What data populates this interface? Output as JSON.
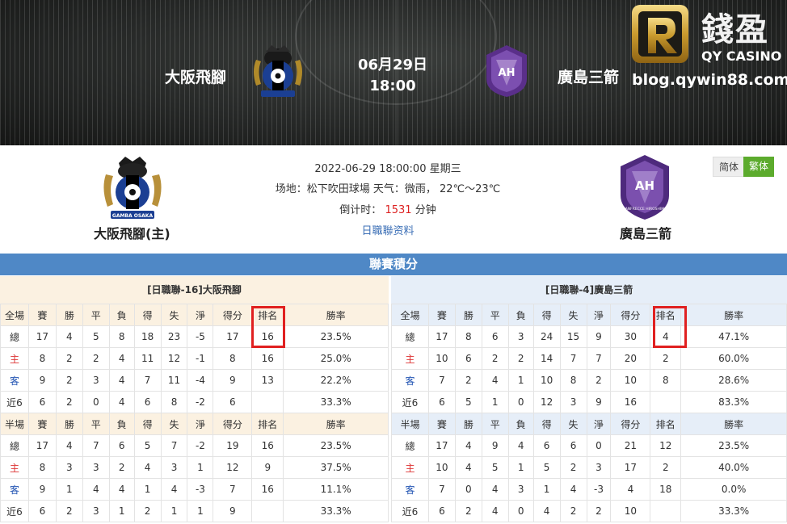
{
  "banner": {
    "home_team": "大阪飛腳",
    "away_team": "廣島三箭",
    "date": "06月29日",
    "time": "18:00",
    "home_logo_text": "GAMBA OSAKA",
    "away_logo_text": "SANFRECCE HIROSHIMA"
  },
  "brand": {
    "name_cn": "錢盈",
    "name_en": "QY CASINO",
    "url": "blog.qywin88.com"
  },
  "match": {
    "home_label": "大阪飛腳(主)",
    "away_label": "廣島三箭",
    "datetime": "2022-06-29 18:00:00 星期三",
    "venue_line": "场地：松下吹田球場 天气：微雨， 22℃～23℃",
    "countdown_label": "倒计时：",
    "countdown_value": "1531",
    "countdown_unit": "分钟",
    "league_link": "日職聯资料"
  },
  "lang": {
    "simplified": "简体",
    "traditional": "繁体"
  },
  "standings": {
    "title": "聯賽積分",
    "home": {
      "team_header": "[日職聯-16]大阪飛腳",
      "full_headers": [
        "全場",
        "賽",
        "勝",
        "平",
        "負",
        "得",
        "失",
        "淨",
        "得分",
        "排名",
        "勝率"
      ],
      "full_rows": [
        [
          "總",
          "17",
          "4",
          "5",
          "8",
          "18",
          "23",
          "-5",
          "17",
          "16",
          "23.5%"
        ],
        [
          "主",
          "8",
          "2",
          "2",
          "4",
          "11",
          "12",
          "-1",
          "8",
          "16",
          "25.0%"
        ],
        [
          "客",
          "9",
          "2",
          "3",
          "4",
          "7",
          "11",
          "-4",
          "9",
          "13",
          "22.2%"
        ],
        [
          "近6",
          "6",
          "2",
          "0",
          "4",
          "6",
          "8",
          "-2",
          "6",
          "",
          "33.3%"
        ]
      ],
      "half_headers": [
        "半場",
        "賽",
        "勝",
        "平",
        "負",
        "得",
        "失",
        "淨",
        "得分",
        "排名",
        "勝率"
      ],
      "half_rows": [
        [
          "總",
          "17",
          "4",
          "7",
          "6",
          "5",
          "7",
          "-2",
          "19",
          "16",
          "23.5%"
        ],
        [
          "主",
          "8",
          "3",
          "3",
          "2",
          "4",
          "3",
          "1",
          "12",
          "9",
          "37.5%"
        ],
        [
          "客",
          "9",
          "1",
          "4",
          "4",
          "1",
          "4",
          "-3",
          "7",
          "16",
          "11.1%"
        ],
        [
          "近6",
          "6",
          "2",
          "3",
          "1",
          "2",
          "1",
          "1",
          "9",
          "",
          "33.3%"
        ]
      ]
    },
    "away": {
      "team_header": "[日職聯-4]廣島三箭",
      "full_headers": [
        "全場",
        "賽",
        "勝",
        "平",
        "負",
        "得",
        "失",
        "淨",
        "得分",
        "排名",
        "勝率"
      ],
      "full_rows": [
        [
          "總",
          "17",
          "8",
          "6",
          "3",
          "24",
          "15",
          "9",
          "30",
          "4",
          "47.1%"
        ],
        [
          "主",
          "10",
          "6",
          "2",
          "2",
          "14",
          "7",
          "7",
          "20",
          "2",
          "60.0%"
        ],
        [
          "客",
          "7",
          "2",
          "4",
          "1",
          "10",
          "8",
          "2",
          "10",
          "8",
          "28.6%"
        ],
        [
          "近6",
          "6",
          "5",
          "1",
          "0",
          "12",
          "3",
          "9",
          "16",
          "",
          "83.3%"
        ]
      ],
      "half_headers": [
        "半場",
        "賽",
        "勝",
        "平",
        "負",
        "得",
        "失",
        "淨",
        "得分",
        "排名",
        "勝率"
      ],
      "half_rows": [
        [
          "總",
          "17",
          "4",
          "9",
          "4",
          "6",
          "6",
          "0",
          "21",
          "12",
          "23.5%"
        ],
        [
          "主",
          "10",
          "4",
          "5",
          "1",
          "5",
          "2",
          "3",
          "17",
          "2",
          "40.0%"
        ],
        [
          "客",
          "7",
          "0",
          "4",
          "3",
          "1",
          "4",
          "-3",
          "4",
          "18",
          "0.0%"
        ],
        [
          "近6",
          "6",
          "2",
          "4",
          "0",
          "4",
          "2",
          "2",
          "10",
          "",
          "33.3%"
        ]
      ]
    }
  },
  "colors": {
    "title_bar": "#4f88c6",
    "home_header_bg": "#fbf1e1",
    "away_header_bg": "#e6eef8",
    "highlight": "#e02020",
    "home_label": "#d33",
    "away_label": "#2355b3",
    "lang_active": "#5cab2d"
  }
}
